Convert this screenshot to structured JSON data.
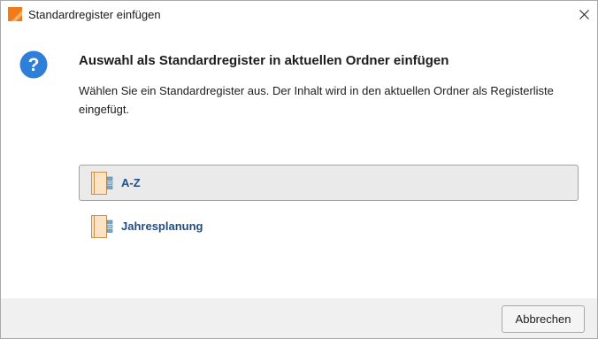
{
  "window": {
    "title": "Standardregister einfügen",
    "app_icon": "app-logo-icon",
    "close_icon": "close-icon"
  },
  "dialog": {
    "icon": "question-icon",
    "heading": "Auswahl als Standardregister in aktuellen Ordner einfügen",
    "description": "Wählen Sie ein Standardregister aus. Der Inhalt wird in den aktuellen Ordner als Registerliste eingefügt.",
    "options": [
      {
        "label": "A-Z",
        "icon": "register-icon",
        "selected": true
      },
      {
        "label": "Jahresplanung",
        "icon": "register-icon",
        "selected": false
      }
    ]
  },
  "footer": {
    "cancel_label": "Abbrechen"
  },
  "colors": {
    "accent_blue": "#1d4f86",
    "question_blue": "#2f7fd9",
    "app_orange": "#f07b18",
    "selected_bg": "#eaeaea",
    "footer_bg": "#f0f0f0"
  }
}
